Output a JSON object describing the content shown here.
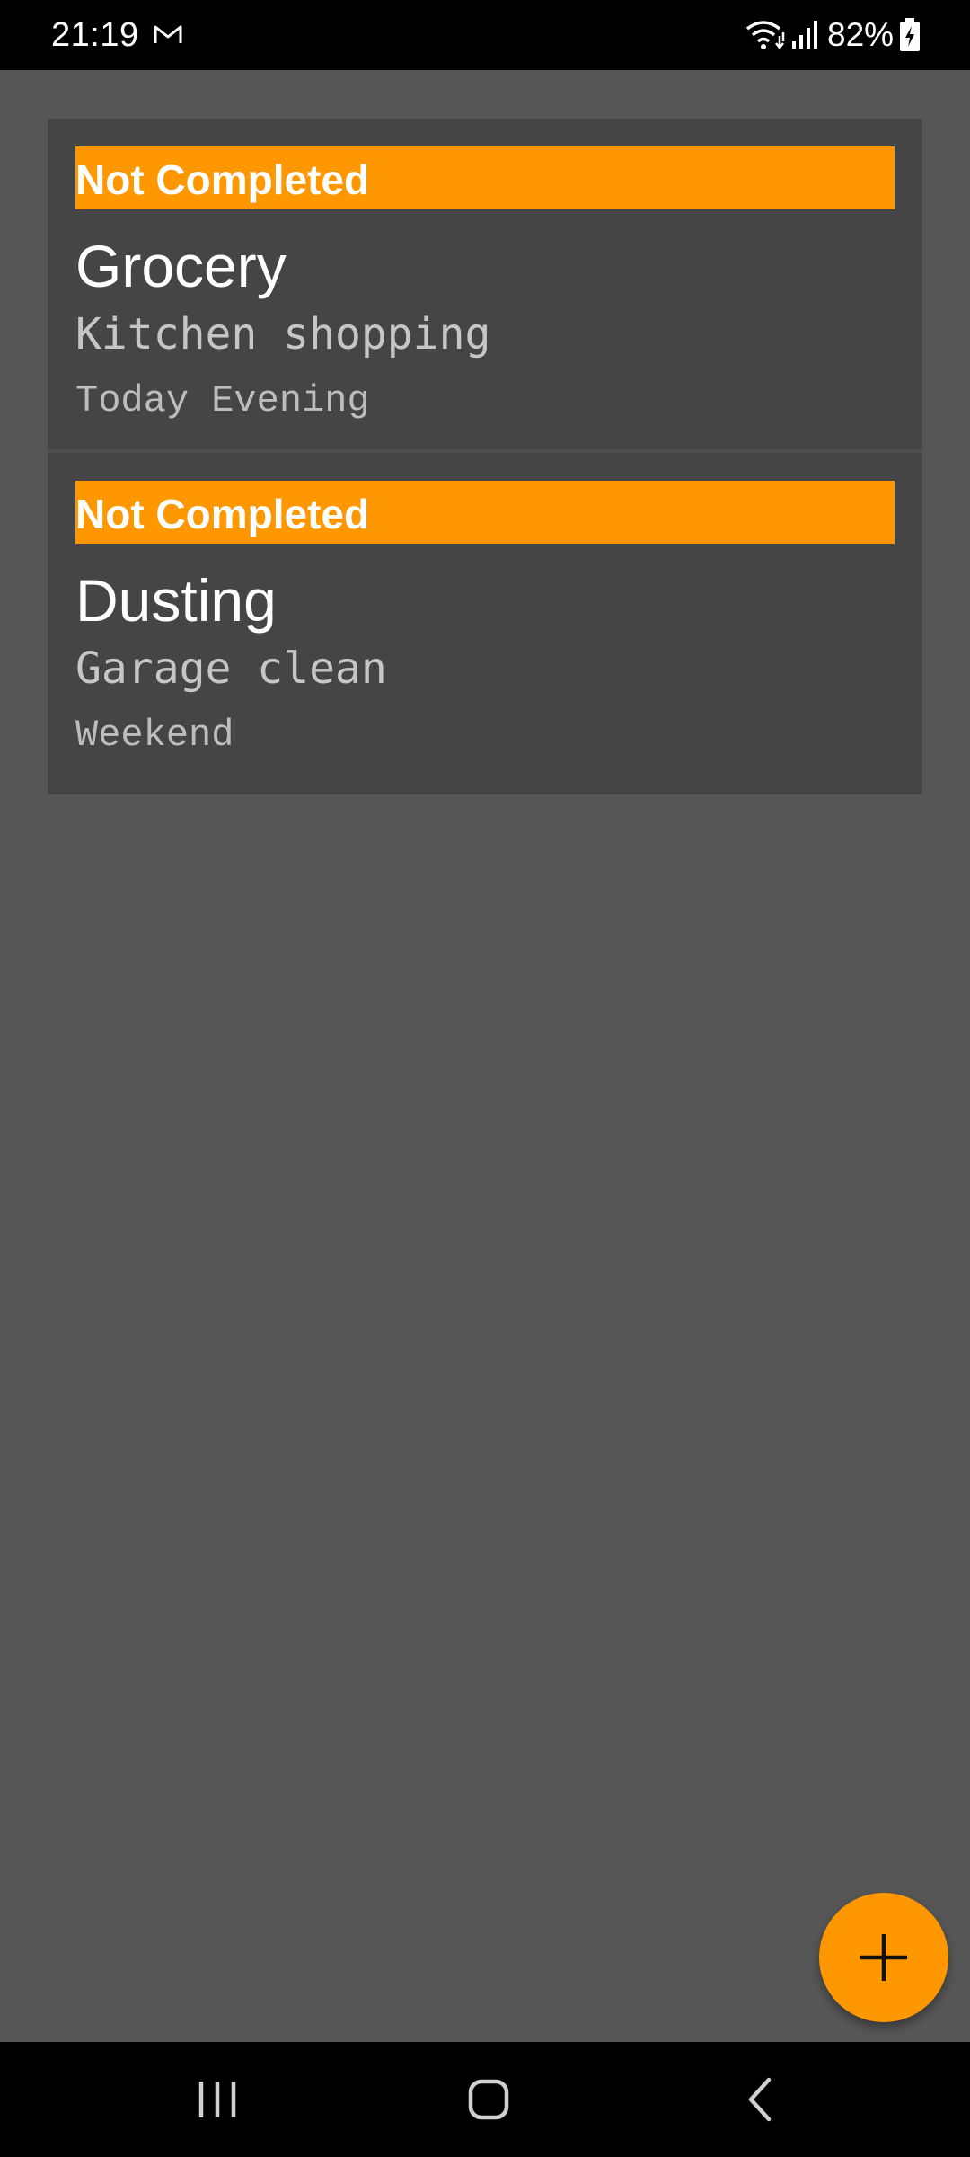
{
  "status_bar": {
    "time": "21:19",
    "notification_icon": "gmail-icon",
    "battery_percent": "82%",
    "icons": [
      "wifi-icon",
      "signal-icon",
      "battery-charging-icon"
    ]
  },
  "tasks": [
    {
      "status": "Not Completed",
      "title": "Grocery",
      "description": "Kitchen shopping",
      "date": "Today Evening"
    },
    {
      "status": "Not Completed",
      "title": "Dusting",
      "description": "Garage clean",
      "date": "Weekend"
    }
  ],
  "fab": {
    "icon": "plus-icon"
  },
  "nav": {
    "icons": [
      "recent-apps-icon",
      "home-icon",
      "back-icon"
    ]
  },
  "colors": {
    "accent": "#ff9800",
    "background": "#565656",
    "card": "#454545"
  }
}
